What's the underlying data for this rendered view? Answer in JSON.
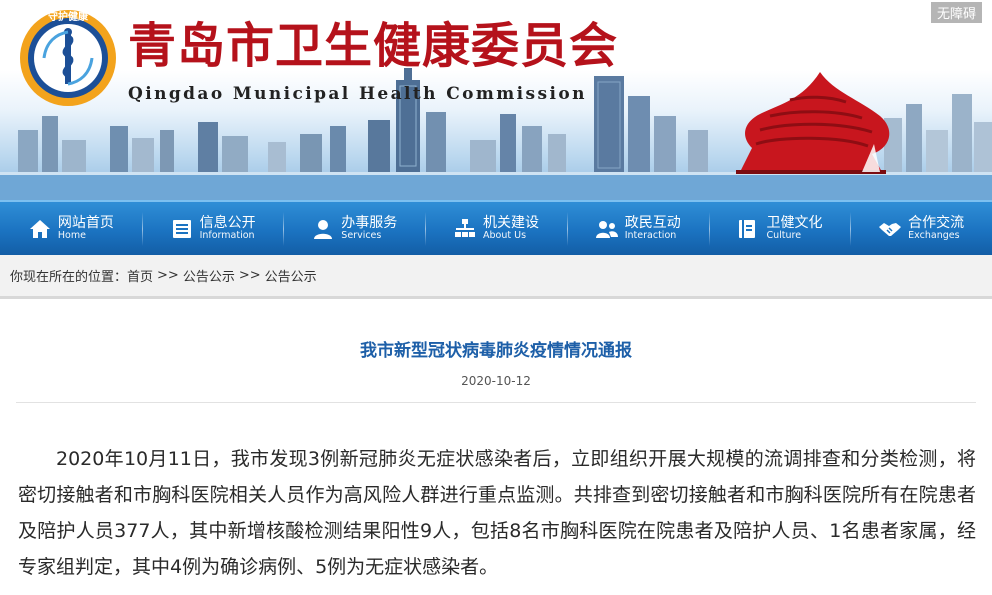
{
  "header": {
    "title_cn": "青岛市卫生健康委员会",
    "title_en": "Qingdao Municipal Health Commission",
    "accessibility": "无障碍",
    "emblem_top_text": "守护健康",
    "emblem_ring_text": "青岛市卫生健康委员会"
  },
  "nav": [
    {
      "cn": "网站首页",
      "en": "Home",
      "icon": "home-icon"
    },
    {
      "cn": "信息公开",
      "en": "Information",
      "icon": "document-list-icon"
    },
    {
      "cn": "办事服务",
      "en": "Services",
      "icon": "user-service-icon"
    },
    {
      "cn": "机关建设",
      "en": "About Us",
      "icon": "org-chart-icon"
    },
    {
      "cn": "政民互动",
      "en": "Interaction",
      "icon": "people-icon"
    },
    {
      "cn": "卫健文化",
      "en": "Culture",
      "icon": "book-icon"
    },
    {
      "cn": "合作交流",
      "en": "Exchanges",
      "icon": "handshake-icon"
    }
  ],
  "breadcrumb": {
    "prefix": "你现在所在的位置：",
    "items": [
      "首页",
      "公告公示",
      "公告公示"
    ],
    "separator": ">>"
  },
  "article": {
    "title": "我市新型冠状病毒肺炎疫情情况通报",
    "date": "2020-10-12",
    "paragraph": "2020年10月11日，我市发现3例新冠肺炎无症状感染者后，立即组织开展大规模的流调排查和分类检测，将密切接触者和市胸科医院相关人员作为高风险人群进行重点监测。共排查到密切接触者和市胸科医院所有在院患者及陪护人员377人，其中新增核酸检测结果阳性9人，包括8名市胸科医院在院患者及陪护人员、1名患者家属，经专家组判定，其中4例为确诊病例、5例为无症状感染者。"
  },
  "colors": {
    "brand_red": "#b5121b",
    "nav_blue": "#1b73c1",
    "title_blue": "#1d5fa8"
  }
}
